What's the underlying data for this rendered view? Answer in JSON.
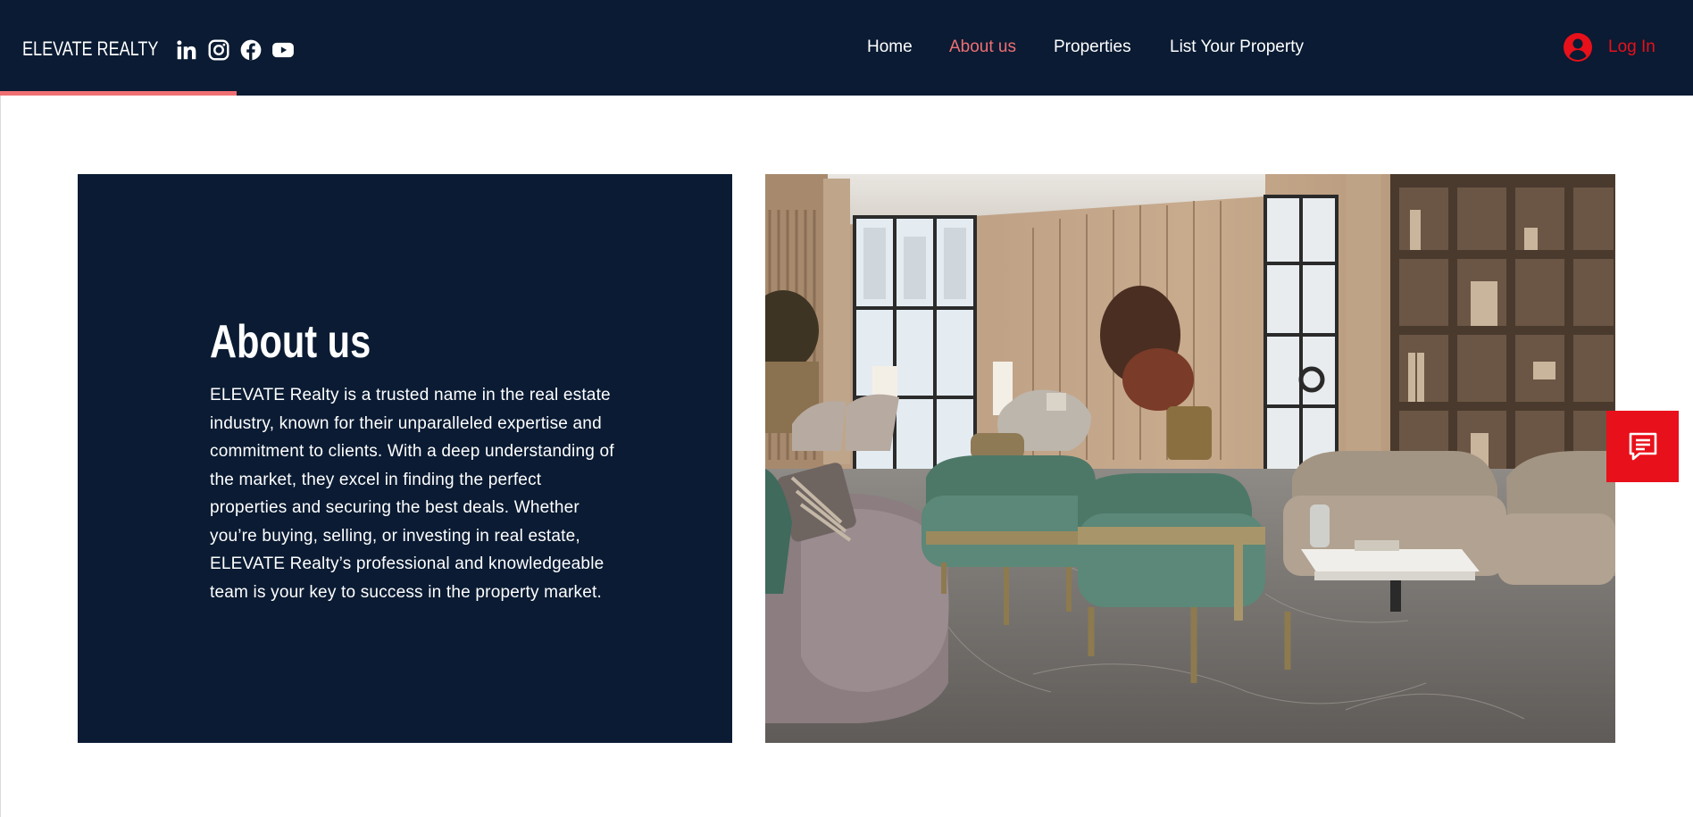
{
  "header": {
    "brand": "ELEVATE REALTY",
    "social_icons": [
      "linkedin-icon",
      "instagram-icon",
      "facebook-icon",
      "youtube-icon"
    ],
    "nav": [
      {
        "label": "Home",
        "active": false
      },
      {
        "label": "About us",
        "active": true
      },
      {
        "label": "Properties",
        "active": false
      },
      {
        "label": "List Your Property",
        "active": false
      }
    ],
    "login": {
      "icon": "user-avatar-icon",
      "label": "Log In"
    }
  },
  "colors": {
    "navy": "#0a1b33",
    "accent": "#ef6f73",
    "login_red": "#e8101a",
    "chat_red": "#e8101a",
    "white": "#ffffff"
  },
  "about": {
    "title": "About us",
    "body": "ELEVATE Realty is a trusted name in the real estate industry, known for their unparalleled expertise and commitment to clients. With a deep understanding of the market, they excel in finding the perfect properties and securing the best deals. Whether you’re buying, selling, or investing in real estate, ELEVATE Realty’s professional and knowledgeable team is your key to success in the property market."
  },
  "image": {
    "subject": "luxury-lobby-interior-photo"
  },
  "chat": {
    "icon": "chat-icon"
  }
}
